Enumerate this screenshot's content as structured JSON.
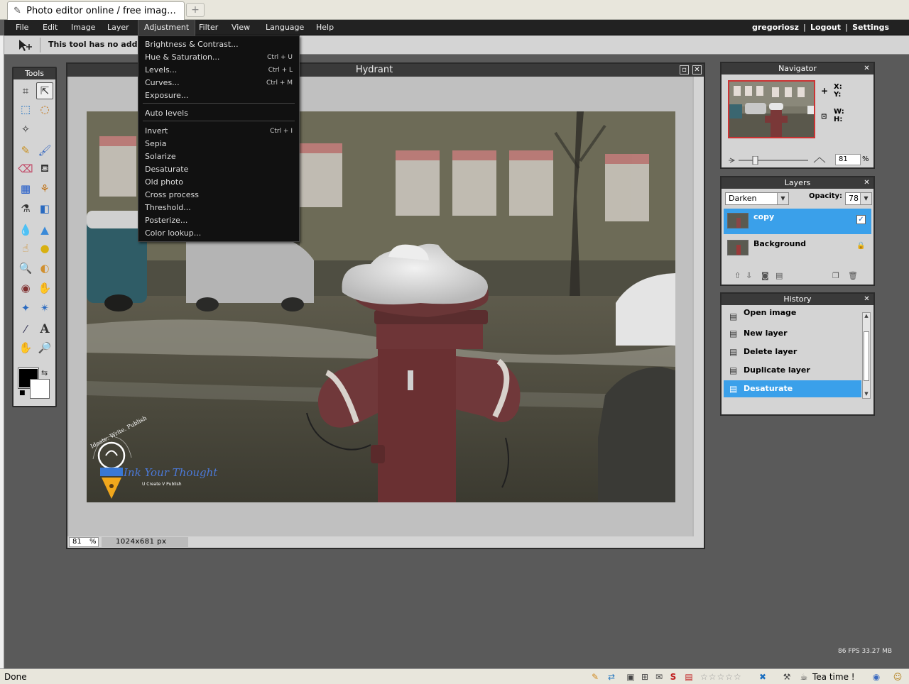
{
  "browser": {
    "tab_title": "Photo editor online / free imag...",
    "new_tab_symbol": "+",
    "status": "Done",
    "tea_time": "Tea time !"
  },
  "menubar": {
    "items": [
      "File",
      "Edit",
      "Image",
      "Layer",
      "Adjustment",
      "Filter",
      "View",
      "Language",
      "Help"
    ],
    "active": "Adjustment",
    "username": "gregoriosz",
    "logout": "Logout",
    "settings": "Settings"
  },
  "options_bar": {
    "message": "This tool has no additional options"
  },
  "tools_panel": {
    "title": "Tools",
    "tools": [
      "crop-icon",
      "move-icon",
      "marquee-icon",
      "lasso-icon",
      "magic-wand-icon",
      "pencil-icon",
      "brush-icon",
      "eraser-icon",
      "bucket-icon",
      "gradient-icon",
      "stamp-icon",
      "color-replace-icon",
      "shape-icon",
      "drop-icon",
      "sharpen-icon",
      "smudge-icon",
      "sponge-icon",
      "zoom-icon",
      "dodge-icon",
      "red-eye-icon",
      "burn-icon",
      "bloat-icon",
      "pinch-icon",
      "picker-icon",
      "type-icon",
      "hand-icon",
      "magnifier-icon"
    ]
  },
  "image_window": {
    "title": "Hydrant",
    "zoom": "81",
    "zoom_unit": "%",
    "dimensions": "1024x681 px"
  },
  "adjustment_menu": {
    "items": [
      {
        "label": "Brightness & Contrast...",
        "shortcut": ""
      },
      {
        "label": "Hue & Saturation...",
        "shortcut": "Ctrl + U"
      },
      {
        "label": "Levels...",
        "shortcut": "Ctrl + L"
      },
      {
        "label": "Curves...",
        "shortcut": "Ctrl + M"
      },
      {
        "label": "Exposure...",
        "shortcut": ""
      },
      {
        "label": "Auto levels",
        "shortcut": ""
      },
      {
        "label": "Invert",
        "shortcut": "Ctrl + I"
      },
      {
        "label": "Sepia",
        "shortcut": ""
      },
      {
        "label": "Solarize",
        "shortcut": ""
      },
      {
        "label": "Desaturate",
        "shortcut": ""
      },
      {
        "label": "Old photo",
        "shortcut": ""
      },
      {
        "label": "Cross process",
        "shortcut": ""
      },
      {
        "label": "Threshold...",
        "shortcut": ""
      },
      {
        "label": "Posterize...",
        "shortcut": ""
      },
      {
        "label": "Color lookup...",
        "shortcut": ""
      }
    ]
  },
  "navigator": {
    "title": "Navigator",
    "x_label": "X:",
    "y_label": "Y:",
    "w_label": "W:",
    "h_label": "H:",
    "zoom": "81",
    "zoom_unit": "%"
  },
  "layers": {
    "title": "Layers",
    "blend_mode": "Darken",
    "opacity_label": "Opacity:",
    "opacity": "78",
    "items": [
      {
        "name": "copy",
        "selected": true
      },
      {
        "name": "Background",
        "selected": false
      }
    ]
  },
  "history": {
    "title": "History",
    "items": [
      "Open image",
      "New layer",
      "Delete layer",
      "Duplicate layer",
      "Desaturate"
    ],
    "selected": "Desaturate"
  },
  "watermark": {
    "arc_text": "Ideate. Write. Publish",
    "brand": "Ink Your Thought",
    "tagline": "U Create V Publish"
  },
  "footer": {
    "fps": "86 FPS 33.27 MB"
  }
}
